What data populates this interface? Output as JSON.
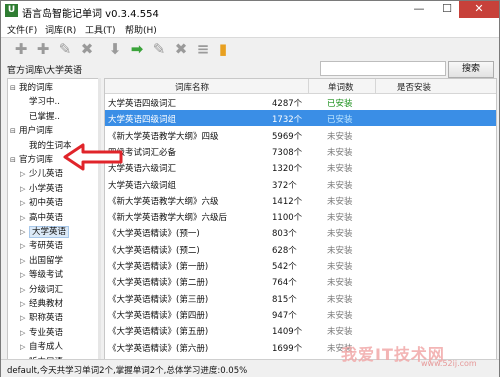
{
  "window": {
    "title": "语言岛智能记单词 v0.3.4.554",
    "app_icon": "U",
    "minimize_icon": "—",
    "maximize_icon": "☐",
    "close_icon": "✕"
  },
  "menu": [
    "文件(F)",
    "词库(R)",
    "工具(T)",
    "帮助(H)"
  ],
  "toolbar": {
    "icons": [
      "add-icon",
      "add-icon",
      "edit-icon",
      "delete-icon",
      "move-down-icon",
      "move-right-icon",
      "edit-icon",
      "delete-icon",
      "list-icon",
      "chart-icon"
    ],
    "glyphs": [
      "✚",
      "✚",
      "✎",
      "✖",
      "⬇",
      "➡",
      "✎",
      "✖",
      "≡",
      "▮"
    ]
  },
  "path": "官方词库\\大学英语",
  "search": {
    "value": "",
    "button_label": "搜索"
  },
  "tree": {
    "nodes": [
      {
        "label": "我的词库",
        "level": 0,
        "toggle": "⊟"
      },
      {
        "label": "学习中..",
        "level": 1,
        "toggle": ""
      },
      {
        "label": "已掌握..",
        "level": 1,
        "toggle": ""
      },
      {
        "label": "用户词库",
        "level": 0,
        "toggle": "⊟"
      },
      {
        "label": "我的生词本",
        "level": 1,
        "toggle": ""
      },
      {
        "label": "官方词库",
        "level": 0,
        "toggle": "⊟"
      },
      {
        "label": "少儿英语",
        "level": 1,
        "toggle": "▷"
      },
      {
        "label": "小学英语",
        "level": 1,
        "toggle": "▷"
      },
      {
        "label": "初中英语",
        "level": 1,
        "toggle": "▷"
      },
      {
        "label": "高中英语",
        "level": 1,
        "toggle": "▷"
      },
      {
        "label": "大学英语",
        "level": 1,
        "toggle": "▷",
        "selected": true
      },
      {
        "label": "考研英语",
        "level": 1,
        "toggle": "▷"
      },
      {
        "label": "出国留学",
        "level": 1,
        "toggle": "▷"
      },
      {
        "label": "等级考试",
        "level": 1,
        "toggle": "▷"
      },
      {
        "label": "分级词汇",
        "level": 1,
        "toggle": "▷"
      },
      {
        "label": "经典教材",
        "level": 1,
        "toggle": "▷"
      },
      {
        "label": "职称英语",
        "level": 1,
        "toggle": "▷"
      },
      {
        "label": "专业英语",
        "level": 1,
        "toggle": "▷"
      },
      {
        "label": "自考成人",
        "level": 1,
        "toggle": "▷"
      },
      {
        "label": "听力口语",
        "level": 1,
        "toggle": "▷"
      }
    ]
  },
  "table": {
    "headers": [
      "词库名称",
      "单词数",
      "是否安装"
    ],
    "rows": [
      {
        "name": "大学英语四级词汇",
        "count": "4287个",
        "status": "已安装",
        "installed": true
      },
      {
        "name": "大学英语四级词组",
        "count": "1732个",
        "status": "已安装",
        "installed": true,
        "selected": true
      },
      {
        "name": "《新大学英语教学大纲》四级",
        "count": "5969个",
        "status": "未安装",
        "installed": false
      },
      {
        "name": "四级考试词汇必备",
        "count": "7308个",
        "status": "未安装",
        "installed": false
      },
      {
        "name": "大学英语六级词汇",
        "count": "1320个",
        "status": "未安装",
        "installed": false
      },
      {
        "name": "大学英语六级词组",
        "count": "372个",
        "status": "未安装",
        "installed": false
      },
      {
        "name": "《新大学英语教学大纲》六级",
        "count": "1412个",
        "status": "未安装",
        "installed": false
      },
      {
        "name": "《新大学英语教学大纲》六级后",
        "count": "1100个",
        "status": "未安装",
        "installed": false
      },
      {
        "name": "《大学英语精读》(预一)",
        "count": "803个",
        "status": "未安装",
        "installed": false
      },
      {
        "name": "《大学英语精读》(预二)",
        "count": "628个",
        "status": "未安装",
        "installed": false
      },
      {
        "name": "《大学英语精读》(第一册)",
        "count": "542个",
        "status": "未安装",
        "installed": false
      },
      {
        "name": "《大学英语精读》(第二册)",
        "count": "764个",
        "status": "未安装",
        "installed": false
      },
      {
        "name": "《大学英语精读》(第三册)",
        "count": "815个",
        "status": "未安装",
        "installed": false
      },
      {
        "name": "《大学英语精读》(第四册)",
        "count": "947个",
        "status": "未安装",
        "installed": false
      },
      {
        "name": "《大学英语精读》(第五册)",
        "count": "1409个",
        "status": "未安装",
        "installed": false
      },
      {
        "name": "《大学英语精读》(第六册)",
        "count": "1699个",
        "status": "未安装",
        "installed": false
      }
    ]
  },
  "status": "default,今天共学习单词2个,掌握单词2个,总体学习进度:0.05%",
  "watermark": {
    "main": "我爱IT技术网",
    "url": "www.52ij.com"
  },
  "colors": {
    "selected_row": "#3a8ee6",
    "installed": "#1a8f1a",
    "annotation_arrow": "#e0242a"
  }
}
